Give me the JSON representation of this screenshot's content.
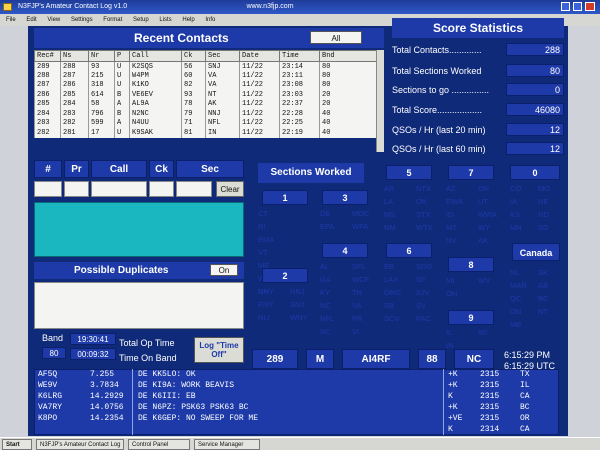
{
  "window": {
    "title": "N3FJP's Amateur Contact Log v1.0",
    "center_title": "www.n3fjp.com"
  },
  "menu": [
    "File",
    "Edit",
    "View",
    "Settings",
    "Format",
    "Setup",
    "Lists",
    "Help",
    "Info"
  ],
  "recent": {
    "title": "Recent Contacts",
    "filter": "All",
    "columns": [
      "Rec#",
      "Ns",
      "Nr",
      "P",
      "Call",
      "Ck",
      "Sec",
      "Date",
      "Time",
      "Bnd"
    ],
    "rows": [
      [
        "289",
        "288",
        "93",
        "U",
        "K2SQS",
        "56",
        "SNJ",
        "11/22",
        "23:14",
        "80"
      ],
      [
        "288",
        "287",
        "215",
        "U",
        "W4PM",
        "60",
        "VA",
        "11/22",
        "23:11",
        "80"
      ],
      [
        "287",
        "286",
        "318",
        "U",
        "K1KO",
        "82",
        "VA",
        "11/22",
        "23:08",
        "80"
      ],
      [
        "286",
        "285",
        "614",
        "B",
        "VE6EV",
        "93",
        "NT",
        "11/22",
        "23:03",
        "20"
      ],
      [
        "285",
        "284",
        "58",
        "A",
        "AL9A",
        "78",
        "AK",
        "11/22",
        "22:37",
        "20"
      ],
      [
        "284",
        "283",
        "796",
        "B",
        "N2NC",
        "79",
        "NNJ",
        "11/22",
        "22:28",
        "40"
      ],
      [
        "283",
        "282",
        "599",
        "A",
        "N4UU",
        "71",
        "NFL",
        "11/22",
        "22:25",
        "40"
      ],
      [
        "282",
        "281",
        "17",
        "U",
        "K9SAK",
        "81",
        "IN",
        "11/22",
        "22:19",
        "40"
      ]
    ]
  },
  "score": {
    "title": "Score Statistics",
    "stats": [
      {
        "label": "Total Contacts.............",
        "value": "288"
      },
      {
        "label": "Total Sections Worked",
        "value": "80"
      },
      {
        "label": "Sections to go ...............",
        "value": "0"
      },
      {
        "label": "Total Score..................",
        "value": "46080"
      },
      {
        "label": "QSOs / Hr (last 20 min)",
        "value": "12"
      },
      {
        "label": "QSOs / Hr (last 60 min)",
        "value": "12"
      }
    ]
  },
  "entry": {
    "headers": [
      "#",
      "Pr",
      "Call",
      "Ck",
      "Sec"
    ],
    "clear": "Clear"
  },
  "duplicates": {
    "title": "Possible Duplicates",
    "toggle": "On"
  },
  "timers": {
    "band_label": "Band",
    "band_value": "80",
    "total_op_value": "19:30:41",
    "total_op_label": "Total Op Time",
    "on_band_value": "00:09:32",
    "on_band_label": "Time On Band",
    "log_off_button": "Log \"Time Off\""
  },
  "sections": {
    "title": "Sections Worked",
    "groups": [
      {
        "id": "1",
        "items": [
          "CT",
          "RI",
          "EMA",
          "VT",
          "ME",
          "WMA",
          "NH"
        ]
      },
      {
        "id": "2",
        "items": [
          "NNY",
          "NNJ",
          "ENY",
          "SNJ",
          "NLI",
          "WNY"
        ]
      },
      {
        "id": "3",
        "items": [
          "DE",
          "MDC",
          "EPA",
          "WPA"
        ]
      },
      {
        "id": "4",
        "items": [
          "AL",
          "SFL",
          "GA",
          "WCF",
          "KY",
          "TN",
          "NC",
          "VA",
          "NFL",
          "PR",
          "SC",
          "VI"
        ]
      },
      {
        "id": "5",
        "items": [
          "AR",
          "NTX",
          "LA",
          "OK",
          "MS",
          "STX",
          "NM",
          "WTX"
        ]
      },
      {
        "id": "6",
        "items": [
          "EB",
          "SDG",
          "LAX",
          "SF",
          "ORG",
          "SJV",
          "SB",
          "SV",
          "SCV",
          "PAC"
        ]
      },
      {
        "id": "7",
        "items": [
          "AZ",
          "OR",
          "EWA",
          "UT",
          "ID",
          "WWA",
          "MT",
          "WY",
          "NV",
          "AK"
        ]
      },
      {
        "id": "8",
        "items": [
          "MI",
          "WV",
          "OH"
        ]
      },
      {
        "id": "9",
        "items": [
          "IL",
          "WI",
          "IN"
        ]
      },
      {
        "id": "0",
        "items": [
          "CO",
          "MO",
          "IA",
          "NE",
          "KS",
          "ND",
          "MN",
          "SD"
        ]
      },
      {
        "id": "Canada",
        "items": [
          "NL",
          "SK",
          "MAR",
          "AB",
          "QC",
          "BC",
          "ON",
          "NT",
          "MB"
        ]
      }
    ]
  },
  "status": {
    "count": "289",
    "mode": "M",
    "mycall": "AI4RF",
    "check": "88",
    "section": "NC",
    "local_time": "6:15:29  PM",
    "utc_time": "6:15:29  UTC"
  },
  "bottom": [
    {
      "call": "AF5Q",
      "freq": "7.255",
      "msg": "DE KK5LO:   OK",
      "sig": "+K",
      "n": "2315",
      "sec": "TX"
    },
    {
      "call": "WE9V",
      "freq": "3.7834",
      "msg": "DE KI9A:   WORK BEAVIS",
      "sig": "+K",
      "n": "2315",
      "sec": "IL"
    },
    {
      "call": "K6LRG",
      "freq": "14.2929",
      "msg": "DE K6III:   EB",
      "sig": "K",
      "n": "2315",
      "sec": "CA"
    },
    {
      "call": "VA7RY",
      "freq": "14.0756",
      "msg": "DE N6PZ:   PSK63 PSK63 BC",
      "sig": "+K",
      "n": "2315",
      "sec": "BC"
    },
    {
      "call": "K8PO",
      "freq": "14.2354",
      "msg": "DE K6GEP:   NO SWEEP FOR ME",
      "sig": "+VE",
      "n": "2315",
      "sec": "OR"
    },
    {
      "call": "",
      "freq": "",
      "msg": "",
      "sig": "K",
      "n": "2314",
      "sec": "CA"
    }
  ],
  "taskbar": [
    "Start",
    "N3FJP's Amateur Contact Log",
    "Control Panel",
    "Service Manager"
  ],
  "colors": {
    "panel_blue": "#1d3aa8",
    "teal": "#1bb7c1",
    "section_text": "#1d3aa8"
  }
}
